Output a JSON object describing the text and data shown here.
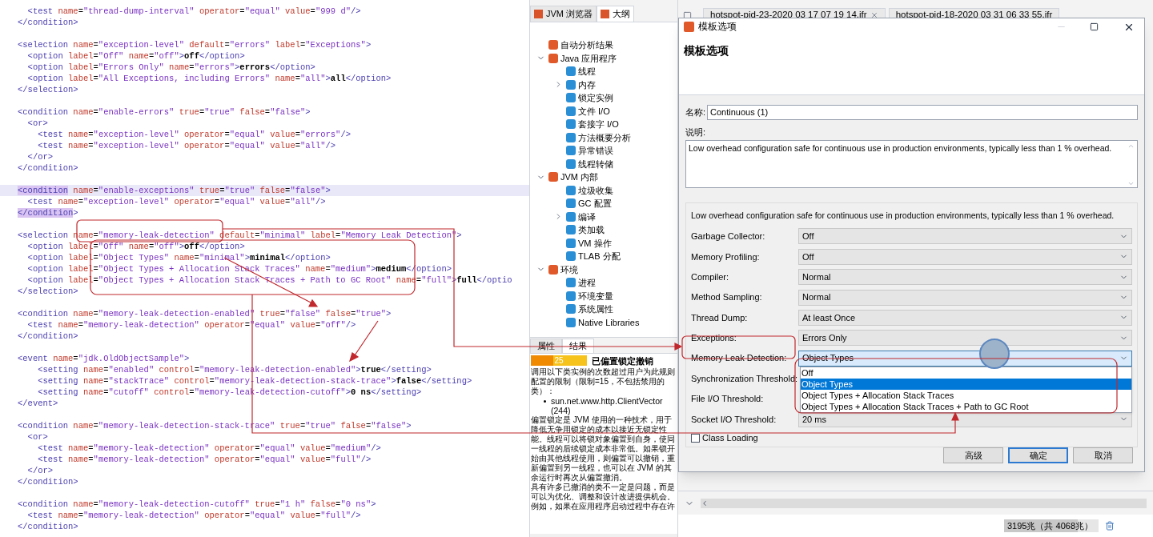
{
  "code": {
    "lines": [
      {
        "kind": "plain",
        "text": "  <test name=\"thread-dump-interval\" operator=\"equal\" value=\"999 d\"/>"
      },
      {
        "kind": "plain",
        "text": "</condition>"
      },
      {
        "kind": "blank"
      },
      {
        "kind": "plain",
        "text": "<selection name=\"exception-level\" default=\"errors\" label=\"Exceptions\">"
      },
      {
        "kind": "plain",
        "text": "  <option label=\"Off\" name=\"off\">off</option>"
      },
      {
        "kind": "plain",
        "text": "  <option label=\"Errors Only\" name=\"errors\">errors</option>"
      },
      {
        "kind": "plain",
        "text": "  <option label=\"All Exceptions, including Errors\" name=\"all\">all</option>"
      },
      {
        "kind": "plain",
        "text": "</selection>"
      },
      {
        "kind": "blank"
      },
      {
        "kind": "plain",
        "text": "<condition name=\"enable-errors\" true=\"true\" false=\"false\">"
      },
      {
        "kind": "plain",
        "text": "  <or>"
      },
      {
        "kind": "plain",
        "text": "    <test name=\"exception-level\" operator=\"equal\" value=\"errors\"/>"
      },
      {
        "kind": "plain",
        "text": "    <test name=\"exception-level\" operator=\"equal\" value=\"all\"/>"
      },
      {
        "kind": "plain",
        "text": "  </or>"
      },
      {
        "kind": "plain",
        "text": "</condition>"
      },
      {
        "kind": "blank"
      },
      {
        "kind": "current",
        "text": "<condition name=\"enable-exceptions\" true=\"true\" false=\"false\">"
      },
      {
        "kind": "plain",
        "text": "  <test name=\"exception-level\" operator=\"equal\" value=\"all\"/>"
      },
      {
        "kind": "bracket",
        "text": "</condition>"
      },
      {
        "kind": "blank"
      },
      {
        "kind": "plain",
        "text": "<selection name=\"memory-leak-detection\" default=\"minimal\" label=\"Memory Leak Detection\">"
      },
      {
        "kind": "plain",
        "text": "  <option label=\"Off\" name=\"off\">off</option>"
      },
      {
        "kind": "plain",
        "text": "  <option label=\"Object Types\" name=\"minimal\">minimal</option>"
      },
      {
        "kind": "plain",
        "text": "  <option label=\"Object Types + Allocation Stack Traces\" name=\"medium\">medium</option>"
      },
      {
        "kind": "plain",
        "text": "  <option label=\"Object Types + Allocation Stack Traces + Path to GC Root\" name=\"full\">full</optio"
      },
      {
        "kind": "plain",
        "text": "</selection>"
      },
      {
        "kind": "blank"
      },
      {
        "kind": "plain",
        "text": "<condition name=\"memory-leak-detection-enabled\" true=\"false\" false=\"true\">"
      },
      {
        "kind": "plain",
        "text": "  <test name=\"memory-leak-detection\" operator=\"equal\" value=\"off\"/>"
      },
      {
        "kind": "plain",
        "text": "</condition>"
      },
      {
        "kind": "blank"
      },
      {
        "kind": "plain",
        "text": "<event name=\"jdk.OldObjectSample\">"
      },
      {
        "kind": "plain",
        "text": "    <setting name=\"enabled\" control=\"memory-leak-detection-enabled\">true</setting>"
      },
      {
        "kind": "plain",
        "text": "    <setting name=\"stackTrace\" control=\"memory-leak-detection-stack-trace\">false</setting>"
      },
      {
        "kind": "plain",
        "text": "    <setting name=\"cutoff\" control=\"memory-leak-detection-cutoff\">0 ns</setting>"
      },
      {
        "kind": "plain",
        "text": "</event>"
      },
      {
        "kind": "blank"
      },
      {
        "kind": "plain",
        "text": "<condition name=\"memory-leak-detection-stack-trace\" true=\"true\" false=\"false\">"
      },
      {
        "kind": "plain",
        "text": "  <or>"
      },
      {
        "kind": "plain",
        "text": "    <test name=\"memory-leak-detection\" operator=\"equal\" value=\"medium\"/>"
      },
      {
        "kind": "plain",
        "text": "    <test name=\"memory-leak-detection\" operator=\"equal\" value=\"full\"/>"
      },
      {
        "kind": "plain",
        "text": "  </or>"
      },
      {
        "kind": "plain",
        "text": "</condition>"
      },
      {
        "kind": "blank"
      },
      {
        "kind": "plain",
        "text": "<condition name=\"memory-leak-detection-cutoff\" true=\"1 h\" false=\"0 ns\">"
      },
      {
        "kind": "plain",
        "text": "  <test name=\"memory-leak-detection\" operator=\"equal\" value=\"full\"/>"
      },
      {
        "kind": "plain",
        "text": "</condition>"
      }
    ]
  },
  "browser": {
    "tabs": [
      {
        "label": "JVM 浏览器",
        "selected": false
      },
      {
        "label": "大纲",
        "selected": true
      }
    ],
    "tree": [
      {
        "label": "自动分析结果"
      },
      {
        "label": "Java 应用程序",
        "expanded": true,
        "children": [
          {
            "label": "线程"
          },
          {
            "label": "内存",
            "expanded": false
          },
          {
            "label": "锁定实例"
          },
          {
            "label": "文件 I/O"
          },
          {
            "label": "套接字 I/O"
          },
          {
            "label": "方法概要分析"
          },
          {
            "label": "异常错误"
          },
          {
            "label": "线程转储"
          }
        ]
      },
      {
        "label": "JVM 内部",
        "expanded": true,
        "children": [
          {
            "label": "垃圾收集"
          },
          {
            "label": "GC 配置"
          },
          {
            "label": "编译",
            "expanded": false
          },
          {
            "label": "类加载"
          },
          {
            "label": "VM 操作"
          },
          {
            "label": "TLAB 分配"
          }
        ]
      },
      {
        "label": "环境",
        "expanded": true,
        "children": [
          {
            "label": "进程"
          },
          {
            "label": "环境变量"
          },
          {
            "label": "系统属性"
          },
          {
            "label": "Native Libraries"
          }
        ]
      }
    ]
  },
  "result": {
    "tabs": [
      {
        "label": "属性",
        "selected": false
      },
      {
        "label": "结果",
        "selected": true
      }
    ],
    "score": "25",
    "level": 0.4,
    "title": "已偏置锁定撤销",
    "intro": "调用以下类实例的次数超过用户为此规则配置的限制（限制=15，不包括禁用的类）：",
    "bullets": [
      "sun.net.www.http.ClientVector (244)"
    ],
    "paragraphs": [
      "偏置锁定是 JVM 使用的一种技术，用于降低无争用锁定的成本以接近无锁定性能。线程可以将锁对象偏置到自身，使同一线程的后续锁定成本非常低。如果锁开始由其他线程使用，则偏置可以撤销，重新偏置到另一线程，也可以在 JVM 的其余运行时再次从偏置撤消。",
      "具有许多已撤消的类不一定是问题，而是可以为优化、调整和设计改进提供机会。例如，如果在应用程序启动过程中存在许"
    ]
  },
  "editor_tabs": [
    {
      "label": "hotspot-pid-23-2020 03 17 07 19 14.jfr",
      "closable": true
    },
    {
      "label": "hotspot-pid-18-2020 03 31 06 33 55.jfr",
      "closable": false
    }
  ],
  "status_bar": {
    "memory": "3195兆（共 4068兆）",
    "level": 0.78
  },
  "dialog": {
    "title": "模板选项",
    "heading": "模板选项",
    "name_label": "名称:",
    "name_value": "Continuous (1)",
    "description_label": "说明:",
    "description_value": "Low overhead configuration safe for continuous use in production environments, typically less than 1 % overhead.",
    "summary": "Low overhead configuration safe for continuous use in production environments, typically less than 1 % overhead.",
    "settings": [
      {
        "kind": "combo",
        "label": "Garbage Collector:",
        "value": "Off",
        "expanded": false
      },
      {
        "kind": "combo",
        "label": "Memory Profiling:",
        "value": "Off",
        "expanded": false
      },
      {
        "kind": "combo",
        "label": "Compiler:",
        "value": "Normal",
        "expanded": false
      },
      {
        "kind": "combo",
        "label": "Method Sampling:",
        "value": "Normal",
        "expanded": false
      },
      {
        "kind": "combo",
        "label": "Thread Dump:",
        "value": "At least Once",
        "expanded": false
      },
      {
        "kind": "combo",
        "label": "Exceptions:",
        "value": "Errors Only",
        "expanded": false
      },
      {
        "kind": "combo",
        "label": "Memory Leak Detection:",
        "value": "Object Types",
        "expanded": true,
        "options": [
          {
            "label": "Off",
            "selected": false
          },
          {
            "label": "Object Types",
            "selected": true
          },
          {
            "label": "Object Types + Allocation Stack Traces",
            "selected": false
          },
          {
            "label": "Object Types + Allocation Stack Traces + Path to GC Root",
            "selected": false
          }
        ]
      },
      {
        "kind": "combo",
        "label": "Synchronization Threshold:"
      },
      {
        "kind": "combo",
        "label": "File I/O Threshold:"
      },
      {
        "kind": "combo",
        "label": "Socket I/O Threshold:",
        "value": "20 ms",
        "expanded": false
      },
      {
        "kind": "checkbox",
        "label": "Class Loading",
        "checked": false
      }
    ],
    "buttons": [
      {
        "label": "高级",
        "default": false
      },
      {
        "label": "确定",
        "default": true
      },
      {
        "label": "取消",
        "default": false
      }
    ]
  }
}
